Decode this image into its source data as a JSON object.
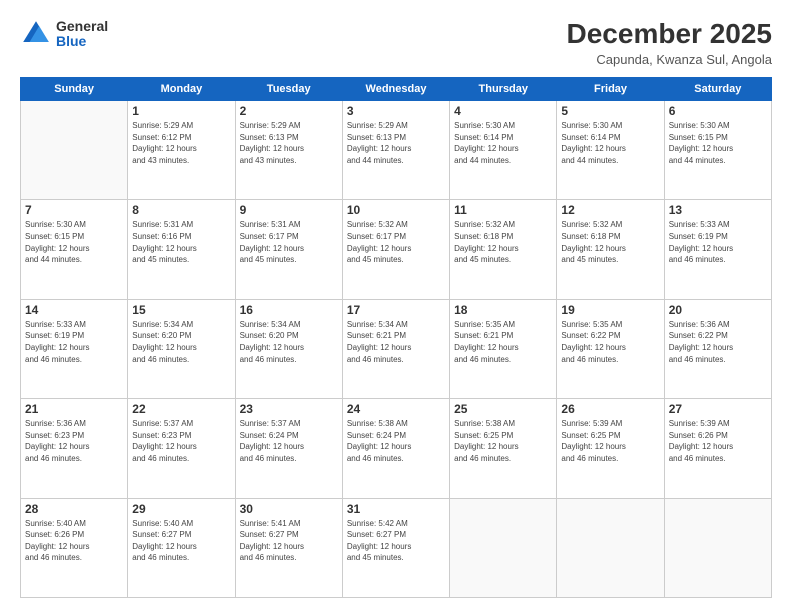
{
  "logo": {
    "general": "General",
    "blue": "Blue"
  },
  "header": {
    "month": "December 2025",
    "location": "Capunda, Kwanza Sul, Angola"
  },
  "weekdays": [
    "Sunday",
    "Monday",
    "Tuesday",
    "Wednesday",
    "Thursday",
    "Friday",
    "Saturday"
  ],
  "weeks": [
    [
      {
        "day": "",
        "info": ""
      },
      {
        "day": "1",
        "info": "Sunrise: 5:29 AM\nSunset: 6:12 PM\nDaylight: 12 hours\nand 43 minutes."
      },
      {
        "day": "2",
        "info": "Sunrise: 5:29 AM\nSunset: 6:13 PM\nDaylight: 12 hours\nand 43 minutes."
      },
      {
        "day": "3",
        "info": "Sunrise: 5:29 AM\nSunset: 6:13 PM\nDaylight: 12 hours\nand 44 minutes."
      },
      {
        "day": "4",
        "info": "Sunrise: 5:30 AM\nSunset: 6:14 PM\nDaylight: 12 hours\nand 44 minutes."
      },
      {
        "day": "5",
        "info": "Sunrise: 5:30 AM\nSunset: 6:14 PM\nDaylight: 12 hours\nand 44 minutes."
      },
      {
        "day": "6",
        "info": "Sunrise: 5:30 AM\nSunset: 6:15 PM\nDaylight: 12 hours\nand 44 minutes."
      }
    ],
    [
      {
        "day": "7",
        "info": "Sunrise: 5:30 AM\nSunset: 6:15 PM\nDaylight: 12 hours\nand 44 minutes."
      },
      {
        "day": "8",
        "info": "Sunrise: 5:31 AM\nSunset: 6:16 PM\nDaylight: 12 hours\nand 45 minutes."
      },
      {
        "day": "9",
        "info": "Sunrise: 5:31 AM\nSunset: 6:17 PM\nDaylight: 12 hours\nand 45 minutes."
      },
      {
        "day": "10",
        "info": "Sunrise: 5:32 AM\nSunset: 6:17 PM\nDaylight: 12 hours\nand 45 minutes."
      },
      {
        "day": "11",
        "info": "Sunrise: 5:32 AM\nSunset: 6:18 PM\nDaylight: 12 hours\nand 45 minutes."
      },
      {
        "day": "12",
        "info": "Sunrise: 5:32 AM\nSunset: 6:18 PM\nDaylight: 12 hours\nand 45 minutes."
      },
      {
        "day": "13",
        "info": "Sunrise: 5:33 AM\nSunset: 6:19 PM\nDaylight: 12 hours\nand 46 minutes."
      }
    ],
    [
      {
        "day": "14",
        "info": "Sunrise: 5:33 AM\nSunset: 6:19 PM\nDaylight: 12 hours\nand 46 minutes."
      },
      {
        "day": "15",
        "info": "Sunrise: 5:34 AM\nSunset: 6:20 PM\nDaylight: 12 hours\nand 46 minutes."
      },
      {
        "day": "16",
        "info": "Sunrise: 5:34 AM\nSunset: 6:20 PM\nDaylight: 12 hours\nand 46 minutes."
      },
      {
        "day": "17",
        "info": "Sunrise: 5:34 AM\nSunset: 6:21 PM\nDaylight: 12 hours\nand 46 minutes."
      },
      {
        "day": "18",
        "info": "Sunrise: 5:35 AM\nSunset: 6:21 PM\nDaylight: 12 hours\nand 46 minutes."
      },
      {
        "day": "19",
        "info": "Sunrise: 5:35 AM\nSunset: 6:22 PM\nDaylight: 12 hours\nand 46 minutes."
      },
      {
        "day": "20",
        "info": "Sunrise: 5:36 AM\nSunset: 6:22 PM\nDaylight: 12 hours\nand 46 minutes."
      }
    ],
    [
      {
        "day": "21",
        "info": "Sunrise: 5:36 AM\nSunset: 6:23 PM\nDaylight: 12 hours\nand 46 minutes."
      },
      {
        "day": "22",
        "info": "Sunrise: 5:37 AM\nSunset: 6:23 PM\nDaylight: 12 hours\nand 46 minutes."
      },
      {
        "day": "23",
        "info": "Sunrise: 5:37 AM\nSunset: 6:24 PM\nDaylight: 12 hours\nand 46 minutes."
      },
      {
        "day": "24",
        "info": "Sunrise: 5:38 AM\nSunset: 6:24 PM\nDaylight: 12 hours\nand 46 minutes."
      },
      {
        "day": "25",
        "info": "Sunrise: 5:38 AM\nSunset: 6:25 PM\nDaylight: 12 hours\nand 46 minutes."
      },
      {
        "day": "26",
        "info": "Sunrise: 5:39 AM\nSunset: 6:25 PM\nDaylight: 12 hours\nand 46 minutes."
      },
      {
        "day": "27",
        "info": "Sunrise: 5:39 AM\nSunset: 6:26 PM\nDaylight: 12 hours\nand 46 minutes."
      }
    ],
    [
      {
        "day": "28",
        "info": "Sunrise: 5:40 AM\nSunset: 6:26 PM\nDaylight: 12 hours\nand 46 minutes."
      },
      {
        "day": "29",
        "info": "Sunrise: 5:40 AM\nSunset: 6:27 PM\nDaylight: 12 hours\nand 46 minutes."
      },
      {
        "day": "30",
        "info": "Sunrise: 5:41 AM\nSunset: 6:27 PM\nDaylight: 12 hours\nand 46 minutes."
      },
      {
        "day": "31",
        "info": "Sunrise: 5:42 AM\nSunset: 6:27 PM\nDaylight: 12 hours\nand 45 minutes."
      },
      {
        "day": "",
        "info": ""
      },
      {
        "day": "",
        "info": ""
      },
      {
        "day": "",
        "info": ""
      }
    ]
  ]
}
